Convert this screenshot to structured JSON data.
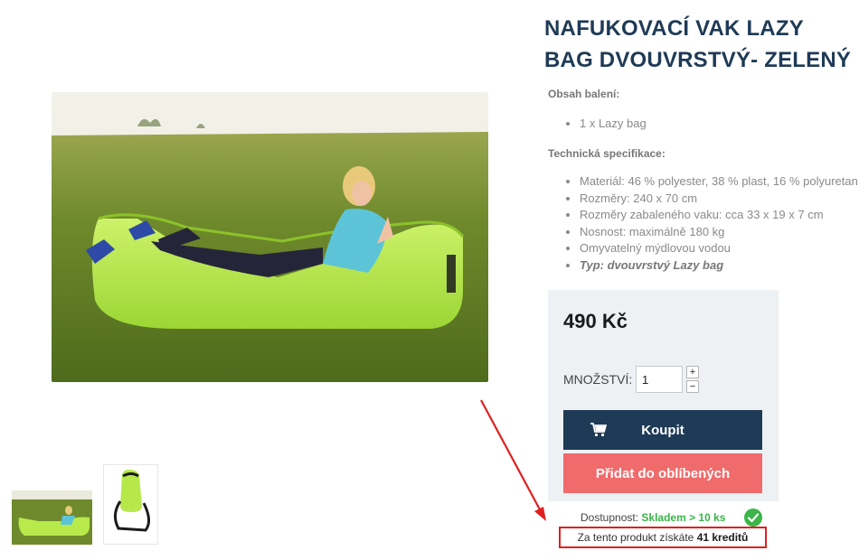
{
  "product": {
    "title": "NAFUKOVACÍ VAK LAZY BAG DVOUVRSTVÝ- ZELENÝ",
    "package_heading": "Obsah balení:",
    "package_items": [
      "1 x Lazy bag"
    ],
    "spec_heading": "Technická specifikace:",
    "spec_items": [
      "Materiál: 46 % polyester, 38 % plast, 16 % polyuretan",
      "Rozměry: 240 x 70 cm",
      "Rozměry zabaleného vaku: cca 33 x 19 x 7 cm",
      "Nosnost: maximálně 180 kg",
      "Omyvatelný mýdlovou vodou",
      "Typ: dvouvrstvý Lazy bag"
    ]
  },
  "buy_box": {
    "price": "490 Kč",
    "quantity_label": "MNOŽSTVÍ:",
    "quantity_value": "1",
    "plus": "+",
    "minus": "−",
    "buy_label": "Koupit",
    "favorite_label": "Přidat do oblíbených"
  },
  "availability": {
    "label": "Dostupnost:",
    "status": "Skladem > 10 ks"
  },
  "credits": {
    "prefix": "Za tento produkt získáte",
    "amount": "41 kreditů"
  },
  "icons": {
    "cart": "cart-icon",
    "check": "check-circle-icon"
  },
  "colors": {
    "title": "#1e3a56",
    "buy_button": "#1e3a56",
    "favorite_button": "#f06b6b",
    "in_stock": "#3bb54a",
    "annotation": "#e02020",
    "lazy_bag": "#b6e84a"
  }
}
